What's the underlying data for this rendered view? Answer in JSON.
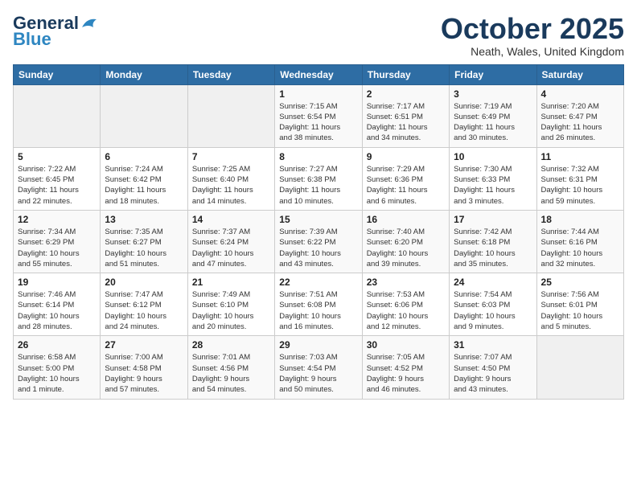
{
  "logo": {
    "text1": "General",
    "text2": "Blue"
  },
  "title": "October 2025",
  "location": "Neath, Wales, United Kingdom",
  "weekdays": [
    "Sunday",
    "Monday",
    "Tuesday",
    "Wednesday",
    "Thursday",
    "Friday",
    "Saturday"
  ],
  "weeks": [
    [
      {
        "day": "",
        "info": ""
      },
      {
        "day": "",
        "info": ""
      },
      {
        "day": "",
        "info": ""
      },
      {
        "day": "1",
        "info": "Sunrise: 7:15 AM\nSunset: 6:54 PM\nDaylight: 11 hours\nand 38 minutes."
      },
      {
        "day": "2",
        "info": "Sunrise: 7:17 AM\nSunset: 6:51 PM\nDaylight: 11 hours\nand 34 minutes."
      },
      {
        "day": "3",
        "info": "Sunrise: 7:19 AM\nSunset: 6:49 PM\nDaylight: 11 hours\nand 30 minutes."
      },
      {
        "day": "4",
        "info": "Sunrise: 7:20 AM\nSunset: 6:47 PM\nDaylight: 11 hours\nand 26 minutes."
      }
    ],
    [
      {
        "day": "5",
        "info": "Sunrise: 7:22 AM\nSunset: 6:45 PM\nDaylight: 11 hours\nand 22 minutes."
      },
      {
        "day": "6",
        "info": "Sunrise: 7:24 AM\nSunset: 6:42 PM\nDaylight: 11 hours\nand 18 minutes."
      },
      {
        "day": "7",
        "info": "Sunrise: 7:25 AM\nSunset: 6:40 PM\nDaylight: 11 hours\nand 14 minutes."
      },
      {
        "day": "8",
        "info": "Sunrise: 7:27 AM\nSunset: 6:38 PM\nDaylight: 11 hours\nand 10 minutes."
      },
      {
        "day": "9",
        "info": "Sunrise: 7:29 AM\nSunset: 6:36 PM\nDaylight: 11 hours\nand 6 minutes."
      },
      {
        "day": "10",
        "info": "Sunrise: 7:30 AM\nSunset: 6:33 PM\nDaylight: 11 hours\nand 3 minutes."
      },
      {
        "day": "11",
        "info": "Sunrise: 7:32 AM\nSunset: 6:31 PM\nDaylight: 10 hours\nand 59 minutes."
      }
    ],
    [
      {
        "day": "12",
        "info": "Sunrise: 7:34 AM\nSunset: 6:29 PM\nDaylight: 10 hours\nand 55 minutes."
      },
      {
        "day": "13",
        "info": "Sunrise: 7:35 AM\nSunset: 6:27 PM\nDaylight: 10 hours\nand 51 minutes."
      },
      {
        "day": "14",
        "info": "Sunrise: 7:37 AM\nSunset: 6:24 PM\nDaylight: 10 hours\nand 47 minutes."
      },
      {
        "day": "15",
        "info": "Sunrise: 7:39 AM\nSunset: 6:22 PM\nDaylight: 10 hours\nand 43 minutes."
      },
      {
        "day": "16",
        "info": "Sunrise: 7:40 AM\nSunset: 6:20 PM\nDaylight: 10 hours\nand 39 minutes."
      },
      {
        "day": "17",
        "info": "Sunrise: 7:42 AM\nSunset: 6:18 PM\nDaylight: 10 hours\nand 35 minutes."
      },
      {
        "day": "18",
        "info": "Sunrise: 7:44 AM\nSunset: 6:16 PM\nDaylight: 10 hours\nand 32 minutes."
      }
    ],
    [
      {
        "day": "19",
        "info": "Sunrise: 7:46 AM\nSunset: 6:14 PM\nDaylight: 10 hours\nand 28 minutes."
      },
      {
        "day": "20",
        "info": "Sunrise: 7:47 AM\nSunset: 6:12 PM\nDaylight: 10 hours\nand 24 minutes."
      },
      {
        "day": "21",
        "info": "Sunrise: 7:49 AM\nSunset: 6:10 PM\nDaylight: 10 hours\nand 20 minutes."
      },
      {
        "day": "22",
        "info": "Sunrise: 7:51 AM\nSunset: 6:08 PM\nDaylight: 10 hours\nand 16 minutes."
      },
      {
        "day": "23",
        "info": "Sunrise: 7:53 AM\nSunset: 6:06 PM\nDaylight: 10 hours\nand 12 minutes."
      },
      {
        "day": "24",
        "info": "Sunrise: 7:54 AM\nSunset: 6:03 PM\nDaylight: 10 hours\nand 9 minutes."
      },
      {
        "day": "25",
        "info": "Sunrise: 7:56 AM\nSunset: 6:01 PM\nDaylight: 10 hours\nand 5 minutes."
      }
    ],
    [
      {
        "day": "26",
        "info": "Sunrise: 6:58 AM\nSunset: 5:00 PM\nDaylight: 10 hours\nand 1 minute."
      },
      {
        "day": "27",
        "info": "Sunrise: 7:00 AM\nSunset: 4:58 PM\nDaylight: 9 hours\nand 57 minutes."
      },
      {
        "day": "28",
        "info": "Sunrise: 7:01 AM\nSunset: 4:56 PM\nDaylight: 9 hours\nand 54 minutes."
      },
      {
        "day": "29",
        "info": "Sunrise: 7:03 AM\nSunset: 4:54 PM\nDaylight: 9 hours\nand 50 minutes."
      },
      {
        "day": "30",
        "info": "Sunrise: 7:05 AM\nSunset: 4:52 PM\nDaylight: 9 hours\nand 46 minutes."
      },
      {
        "day": "31",
        "info": "Sunrise: 7:07 AM\nSunset: 4:50 PM\nDaylight: 9 hours\nand 43 minutes."
      },
      {
        "day": "",
        "info": ""
      }
    ]
  ]
}
